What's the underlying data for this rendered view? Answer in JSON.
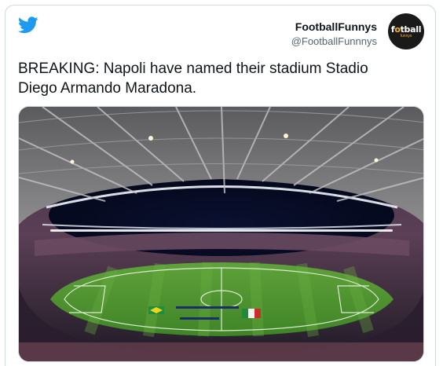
{
  "header": {
    "display_name": "FootballFunnys",
    "handle": "@FootballFunnnys",
    "avatar_text_left": "f",
    "avatar_text_highlight": "o",
    "avatar_text_right": "tball",
    "avatar_subtext": "funnys"
  },
  "tweet": {
    "text": "BREAKING: Napoli have named their stadium Stadio Diego Armando Maradona."
  },
  "icons": {
    "platform": "twitter-bird-icon"
  },
  "colors": {
    "twitter_blue": "#1d9bf0",
    "text_primary": "#0f1419",
    "text_secondary": "#536471",
    "border": "#cfd9de"
  }
}
